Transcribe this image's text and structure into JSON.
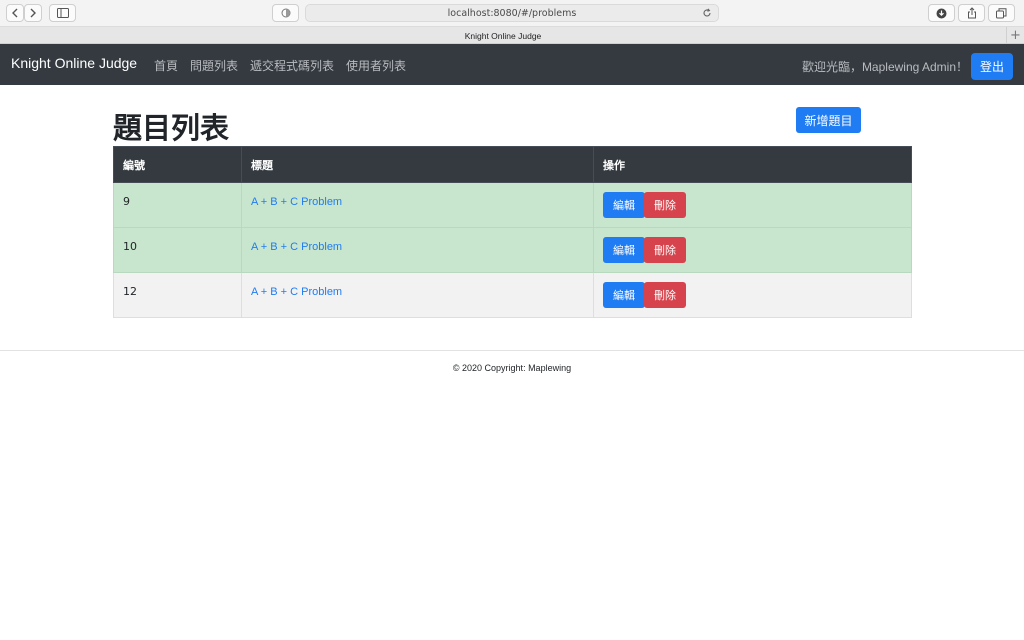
{
  "browser": {
    "url": "localhost:8080/#/problems",
    "tab_title": "Knight Online Judge",
    "new_tab_label": "+"
  },
  "navbar": {
    "brand": "Knight Online Judge",
    "links": [
      "首頁",
      "問題列表",
      "遞交程式碼列表",
      "使用者列表"
    ],
    "welcome": "歡迎光臨，Maplewing Admin！",
    "logout_label": "登出"
  },
  "page": {
    "title": "題目列表",
    "add_button_label": "新增題目"
  },
  "table": {
    "headers": [
      "編號",
      "標題",
      "操作"
    ],
    "rows": [
      {
        "id": "9",
        "title": "A + B + C Problem",
        "edit": "編輯",
        "delete": "刪除"
      },
      {
        "id": "10",
        "title": "A + B + C Problem",
        "edit": "編輯",
        "delete": "刪除"
      },
      {
        "id": "12",
        "title": "A + B + C Problem",
        "edit": "編輯",
        "delete": "刪除"
      }
    ]
  },
  "footer": {
    "copyright": "© 2020 Copyright: Maplewing"
  },
  "colors": {
    "navbar_bg": "#343a40",
    "primary": "#1f7cf3",
    "danger": "#d7434c",
    "success_row": "#c8e6cd"
  }
}
